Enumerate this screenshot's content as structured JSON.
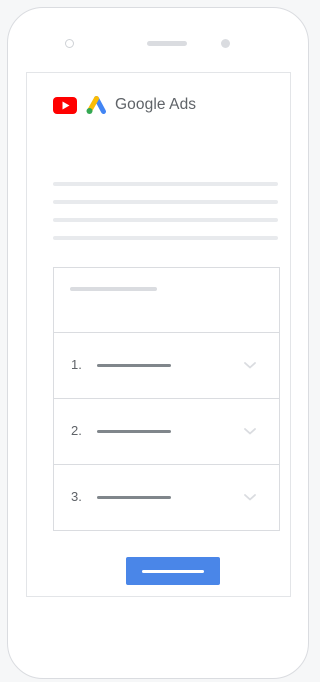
{
  "brand": {
    "name": "Google Ads",
    "youtube_icon": "youtube-play-icon",
    "ads_icon": "google-ads-logo-icon"
  },
  "steps": [
    {
      "number": "1."
    },
    {
      "number": "2."
    },
    {
      "number": "3."
    }
  ],
  "icons": {
    "row_expand": "chevron-down-icon"
  },
  "colors": {
    "youtube_red": "#ff0000",
    "ads_blue": "#4285f4",
    "ads_yellow": "#fbbc04",
    "ads_green": "#34a853",
    "button_blue": "#4a86e8",
    "placeholder_light": "#e8eaed",
    "placeholder_dark": "#80868b"
  }
}
